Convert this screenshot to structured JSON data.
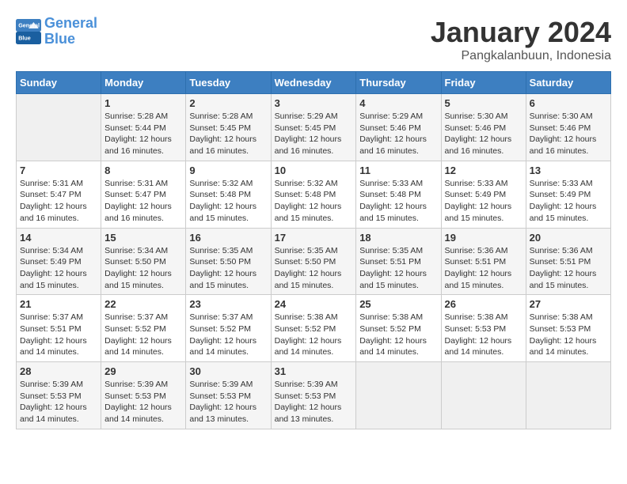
{
  "header": {
    "logo_line1": "General",
    "logo_line2": "Blue",
    "month_year": "January 2024",
    "location": "Pangkalanbuun, Indonesia"
  },
  "columns": [
    "Sunday",
    "Monday",
    "Tuesday",
    "Wednesday",
    "Thursday",
    "Friday",
    "Saturday"
  ],
  "weeks": [
    [
      {
        "day": "",
        "sunrise": "",
        "sunset": "",
        "daylight": ""
      },
      {
        "day": "1",
        "sunrise": "5:28 AM",
        "sunset": "5:44 PM",
        "daylight": "12 hours and 16 minutes."
      },
      {
        "day": "2",
        "sunrise": "5:28 AM",
        "sunset": "5:45 PM",
        "daylight": "12 hours and 16 minutes."
      },
      {
        "day": "3",
        "sunrise": "5:29 AM",
        "sunset": "5:45 PM",
        "daylight": "12 hours and 16 minutes."
      },
      {
        "day": "4",
        "sunrise": "5:29 AM",
        "sunset": "5:46 PM",
        "daylight": "12 hours and 16 minutes."
      },
      {
        "day": "5",
        "sunrise": "5:30 AM",
        "sunset": "5:46 PM",
        "daylight": "12 hours and 16 minutes."
      },
      {
        "day": "6",
        "sunrise": "5:30 AM",
        "sunset": "5:46 PM",
        "daylight": "12 hours and 16 minutes."
      }
    ],
    [
      {
        "day": "7",
        "sunrise": "5:31 AM",
        "sunset": "5:47 PM",
        "daylight": "12 hours and 16 minutes."
      },
      {
        "day": "8",
        "sunrise": "5:31 AM",
        "sunset": "5:47 PM",
        "daylight": "12 hours and 16 minutes."
      },
      {
        "day": "9",
        "sunrise": "5:32 AM",
        "sunset": "5:48 PM",
        "daylight": "12 hours and 15 minutes."
      },
      {
        "day": "10",
        "sunrise": "5:32 AM",
        "sunset": "5:48 PM",
        "daylight": "12 hours and 15 minutes."
      },
      {
        "day": "11",
        "sunrise": "5:33 AM",
        "sunset": "5:48 PM",
        "daylight": "12 hours and 15 minutes."
      },
      {
        "day": "12",
        "sunrise": "5:33 AM",
        "sunset": "5:49 PM",
        "daylight": "12 hours and 15 minutes."
      },
      {
        "day": "13",
        "sunrise": "5:33 AM",
        "sunset": "5:49 PM",
        "daylight": "12 hours and 15 minutes."
      }
    ],
    [
      {
        "day": "14",
        "sunrise": "5:34 AM",
        "sunset": "5:49 PM",
        "daylight": "12 hours and 15 minutes."
      },
      {
        "day": "15",
        "sunrise": "5:34 AM",
        "sunset": "5:50 PM",
        "daylight": "12 hours and 15 minutes."
      },
      {
        "day": "16",
        "sunrise": "5:35 AM",
        "sunset": "5:50 PM",
        "daylight": "12 hours and 15 minutes."
      },
      {
        "day": "17",
        "sunrise": "5:35 AM",
        "sunset": "5:50 PM",
        "daylight": "12 hours and 15 minutes."
      },
      {
        "day": "18",
        "sunrise": "5:35 AM",
        "sunset": "5:51 PM",
        "daylight": "12 hours and 15 minutes."
      },
      {
        "day": "19",
        "sunrise": "5:36 AM",
        "sunset": "5:51 PM",
        "daylight": "12 hours and 15 minutes."
      },
      {
        "day": "20",
        "sunrise": "5:36 AM",
        "sunset": "5:51 PM",
        "daylight": "12 hours and 15 minutes."
      }
    ],
    [
      {
        "day": "21",
        "sunrise": "5:37 AM",
        "sunset": "5:51 PM",
        "daylight": "12 hours and 14 minutes."
      },
      {
        "day": "22",
        "sunrise": "5:37 AM",
        "sunset": "5:52 PM",
        "daylight": "12 hours and 14 minutes."
      },
      {
        "day": "23",
        "sunrise": "5:37 AM",
        "sunset": "5:52 PM",
        "daylight": "12 hours and 14 minutes."
      },
      {
        "day": "24",
        "sunrise": "5:38 AM",
        "sunset": "5:52 PM",
        "daylight": "12 hours and 14 minutes."
      },
      {
        "day": "25",
        "sunrise": "5:38 AM",
        "sunset": "5:52 PM",
        "daylight": "12 hours and 14 minutes."
      },
      {
        "day": "26",
        "sunrise": "5:38 AM",
        "sunset": "5:53 PM",
        "daylight": "12 hours and 14 minutes."
      },
      {
        "day": "27",
        "sunrise": "5:38 AM",
        "sunset": "5:53 PM",
        "daylight": "12 hours and 14 minutes."
      }
    ],
    [
      {
        "day": "28",
        "sunrise": "5:39 AM",
        "sunset": "5:53 PM",
        "daylight": "12 hours and 14 minutes."
      },
      {
        "day": "29",
        "sunrise": "5:39 AM",
        "sunset": "5:53 PM",
        "daylight": "12 hours and 14 minutes."
      },
      {
        "day": "30",
        "sunrise": "5:39 AM",
        "sunset": "5:53 PM",
        "daylight": "12 hours and 13 minutes."
      },
      {
        "day": "31",
        "sunrise": "5:39 AM",
        "sunset": "5:53 PM",
        "daylight": "12 hours and 13 minutes."
      },
      {
        "day": "",
        "sunrise": "",
        "sunset": "",
        "daylight": ""
      },
      {
        "day": "",
        "sunrise": "",
        "sunset": "",
        "daylight": ""
      },
      {
        "day": "",
        "sunrise": "",
        "sunset": "",
        "daylight": ""
      }
    ]
  ]
}
